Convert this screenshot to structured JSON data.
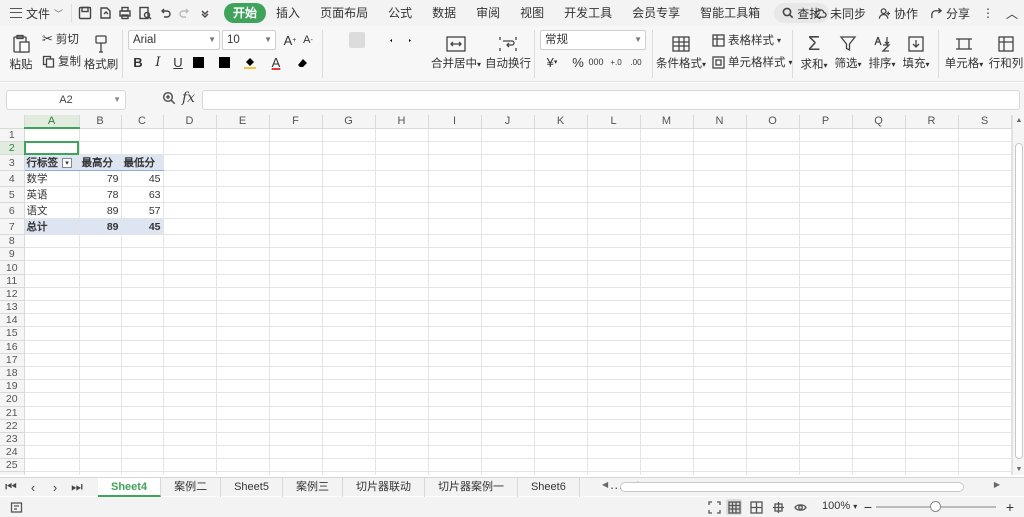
{
  "menubar": {
    "file_label": "文件",
    "tabs": [
      "开始",
      "插入",
      "页面布局",
      "公式",
      "数据",
      "审阅",
      "视图",
      "开发工具",
      "会员专享",
      "智能工具箱"
    ],
    "active_tab": "开始",
    "search_label": "查找",
    "right": {
      "sync": "未同步",
      "collab": "协作",
      "share": "分享"
    }
  },
  "ribbon": {
    "paste": "粘贴",
    "cut": "剪切",
    "copy": "复制",
    "format_painter": "格式刷",
    "font_name": "Arial",
    "font_size": "10",
    "merge_center": "合并居中",
    "wrap_text": "自动换行",
    "number_format": "常规",
    "conditional_format": "条件格式",
    "table_style": "表格样式",
    "cell_style": "单元格样式",
    "sum": "求和",
    "filter": "筛选",
    "sort": "排序",
    "fill": "填充",
    "cell": "单元格",
    "row_col": "行和列",
    "bold": "B",
    "italic": "I",
    "underline": "U",
    "font_color_letter": "A",
    "font_grow": "A",
    "font_shrink": "A",
    "currency": "¥",
    "percent": "%",
    "thousands": "000",
    "dec_inc": "+.0",
    "dec_dec": ".00"
  },
  "formula_bar": {
    "name_box": "A2",
    "fx": "fx",
    "formula": ""
  },
  "grid": {
    "columns": [
      "A",
      "B",
      "C",
      "D",
      "E",
      "F",
      "G",
      "H",
      "I",
      "J",
      "K",
      "L",
      "M",
      "N",
      "O",
      "P",
      "Q",
      "R",
      "S"
    ],
    "row_count": 26,
    "active_cell": "A2",
    "pivot": {
      "header": [
        "行标签",
        "最高分",
        "最低分"
      ],
      "rows": [
        {
          "label": "数学",
          "max": "79",
          "min": "45"
        },
        {
          "label": "英语",
          "max": "78",
          "min": "63"
        },
        {
          "label": "语文",
          "max": "89",
          "min": "57"
        }
      ],
      "total": {
        "label": "总计",
        "max": "89",
        "min": "45"
      }
    }
  },
  "sheets": {
    "tabs": [
      "Sheet4",
      "案例二",
      "Sheet5",
      "案例三",
      "切片器联动",
      "切片器案例一",
      "Sheet6"
    ],
    "active": "Sheet4",
    "more": "···",
    "add": "+"
  },
  "status": {
    "zoom": "100%",
    "zoom_level_percent": 100
  },
  "colors": {
    "accent": "#3fa35c",
    "pivot_fill": "#dde4f2",
    "pivot_border": "#8ea9db"
  }
}
